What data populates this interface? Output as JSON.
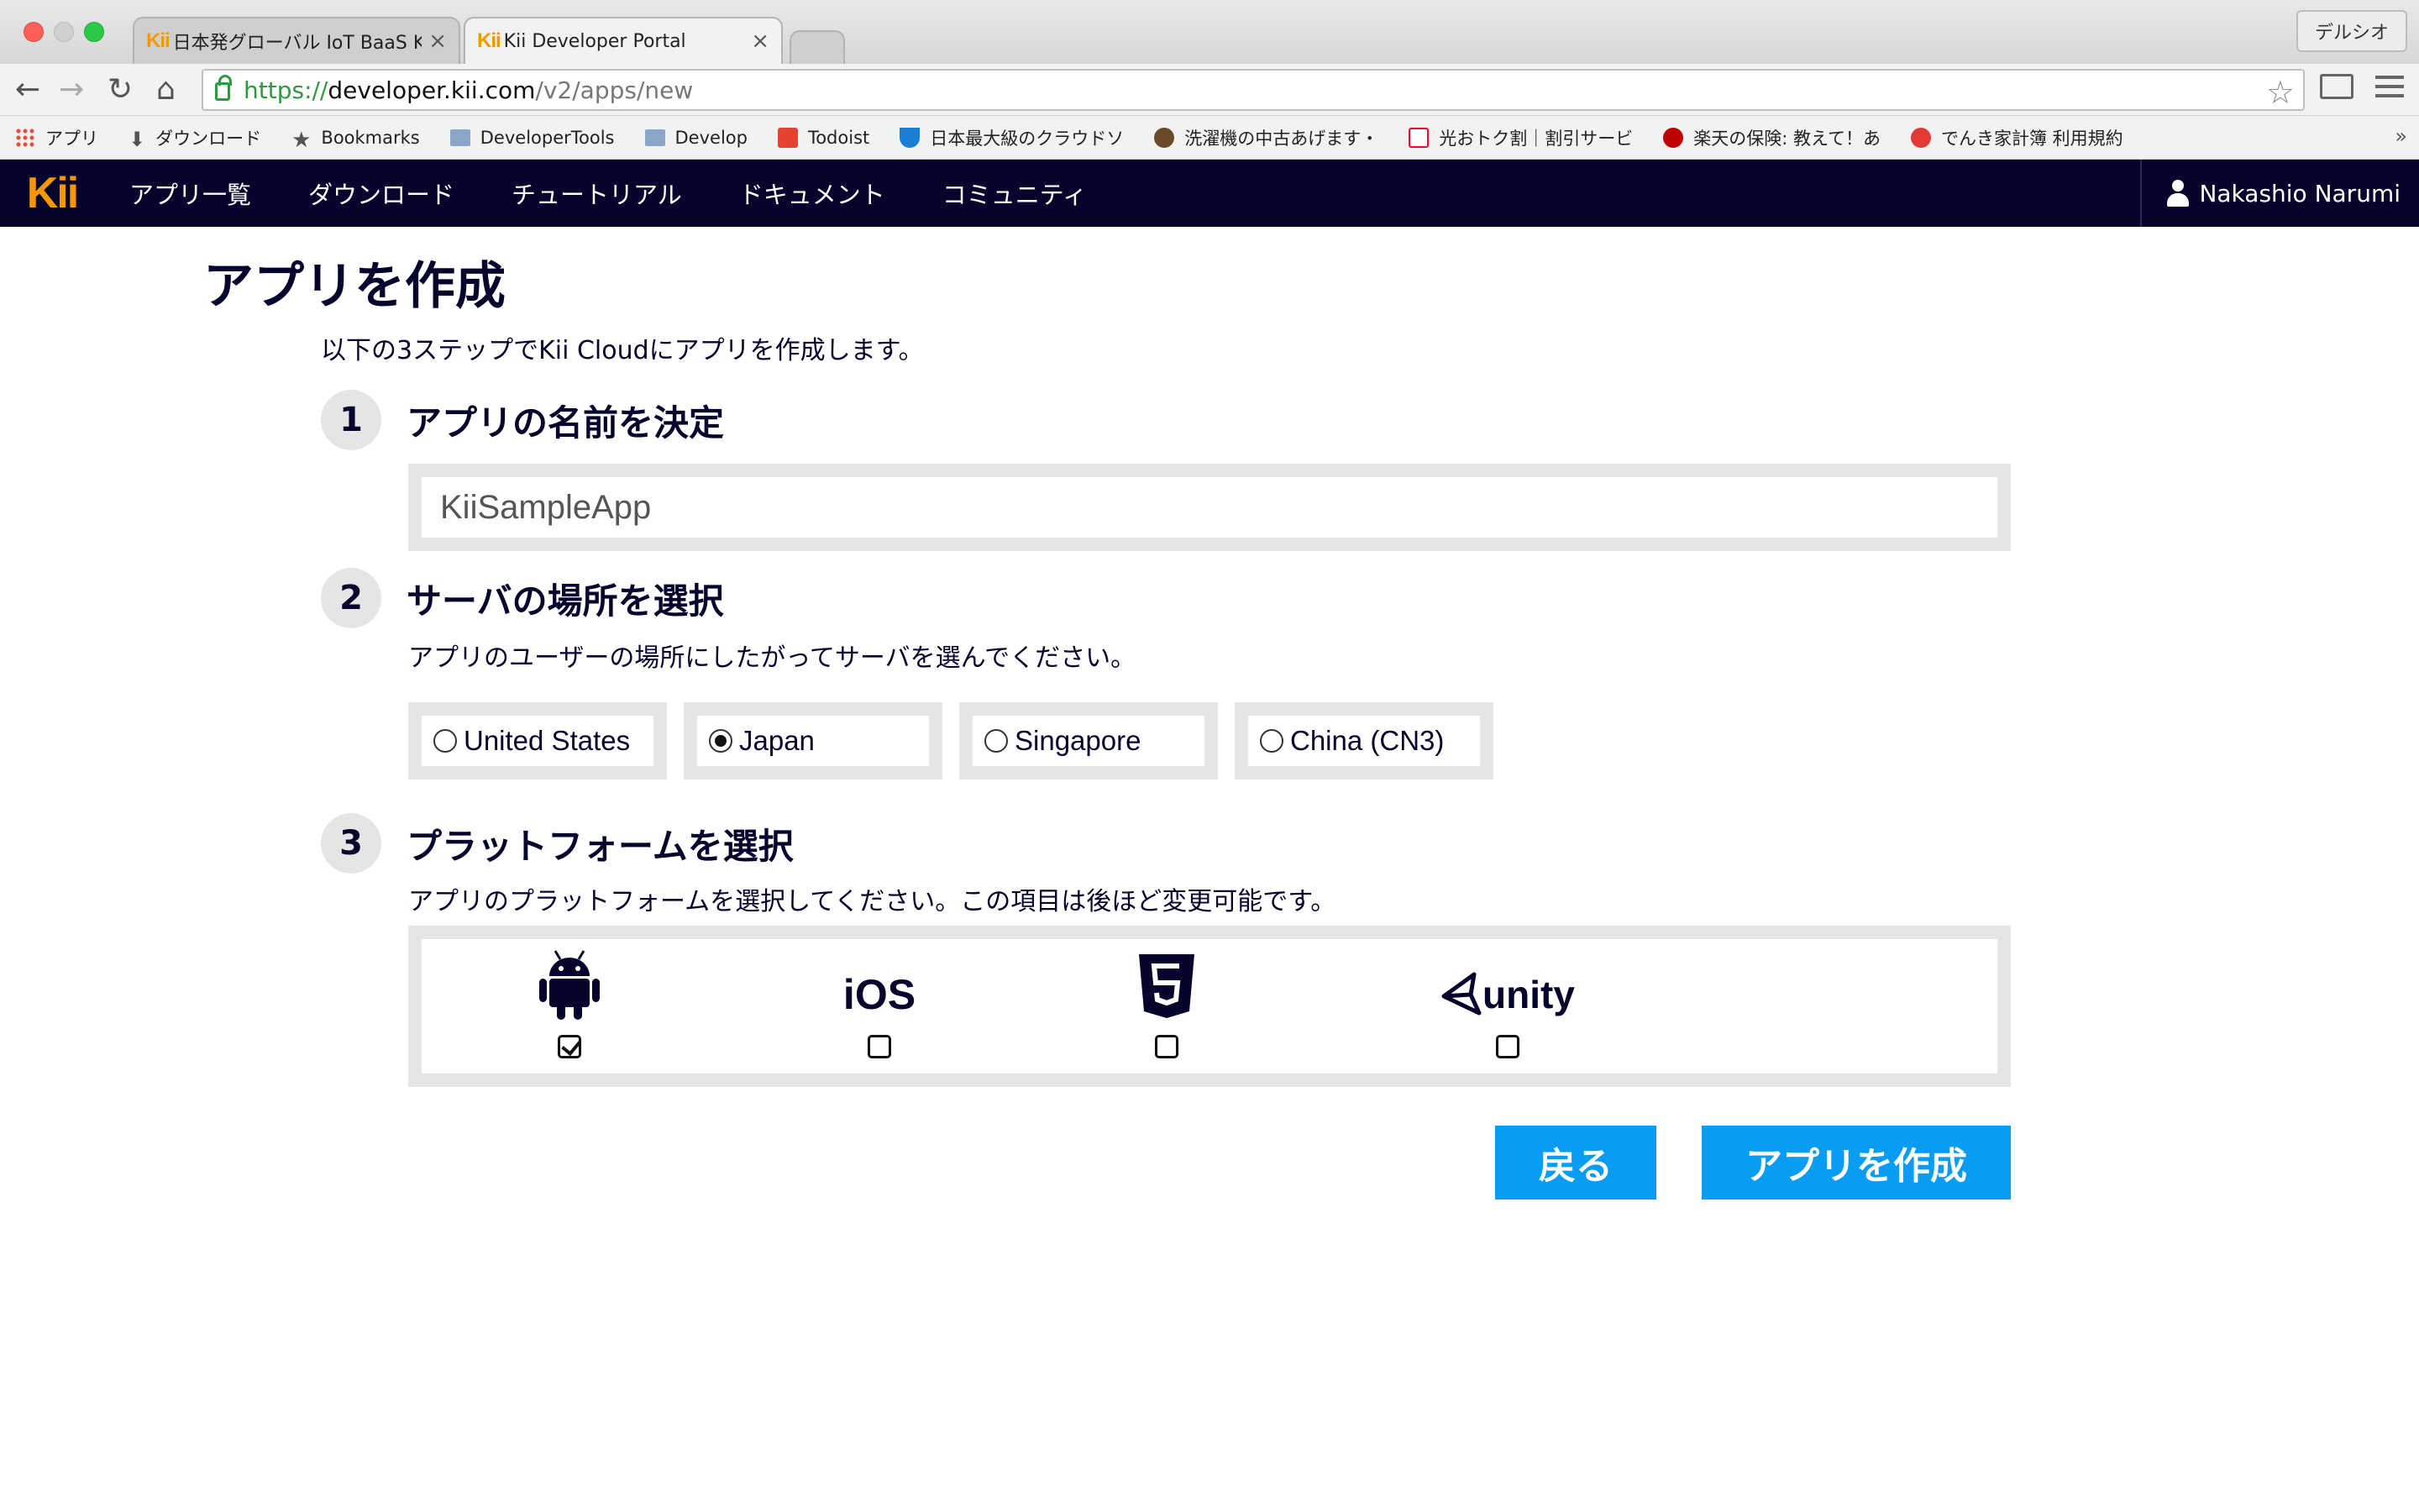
{
  "browser": {
    "tabs": [
      {
        "favicon": "Kii",
        "title": "日本発グローバル IoT BaaS K",
        "close": "×"
      },
      {
        "favicon": "Kii",
        "title": "Kii Developer Portal",
        "close": "×"
      }
    ],
    "profile": "デルシオ",
    "url": {
      "scheme": "https://",
      "host": "developer.kii.com",
      "path": "/v2/apps/new"
    },
    "bookmarks": [
      {
        "icon": "apps-grid-icon",
        "label": "アプリ"
      },
      {
        "icon": "download-icon",
        "label": "ダウンロード"
      },
      {
        "icon": "star-icon",
        "label": "Bookmarks"
      },
      {
        "icon": "folder-icon",
        "label": "DeveloperTools"
      },
      {
        "icon": "folder-icon",
        "label": "Develop"
      },
      {
        "icon": "todoist-icon",
        "label": "Todoist"
      },
      {
        "icon": "u-shield-icon",
        "label": "日本最大級のクラウドソ"
      },
      {
        "icon": "brown-circle-icon",
        "label": "洗濯機の中古あげます・"
      },
      {
        "icon": "yahoo-icon",
        "label": "光おトク割｜割引サービ"
      },
      {
        "icon": "rakuten-icon",
        "label": "楽天の保険: 教えて！あ"
      },
      {
        "icon": "denki-icon",
        "label": "でんき家計簿 利用規約"
      }
    ],
    "bookmarks_more": "»"
  },
  "site_nav": {
    "logo": "Kii",
    "items": [
      "アプリ一覧",
      "ダウンロード",
      "チュートリアル",
      "ドキュメント",
      "コミュニティ"
    ],
    "user": "Nakashio Narumi"
  },
  "page": {
    "title": "アプリを作成",
    "intro": "以下の3ステップでKii Cloudにアプリを作成します。",
    "step1": {
      "number": "1",
      "title": "アプリの名前を決定",
      "app_name_value": "KiiSampleApp"
    },
    "step2": {
      "number": "2",
      "title": "サーバの場所を選択",
      "description": "アプリのユーザーの場所にしたがってサーバを選んでください。",
      "options": [
        "United States",
        "Japan",
        "Singapore",
        "China (CN3)"
      ],
      "selected": "Japan"
    },
    "step3": {
      "number": "3",
      "title": "プラットフォームを選択",
      "description": "アプリのプラットフォームを選択してください。この項目は後ほど変更可能です。",
      "platforms": [
        {
          "name": "Android",
          "icon": "android-icon",
          "checked": true
        },
        {
          "name": "iOS",
          "label": "iOS",
          "checked": false
        },
        {
          "name": "HTML5",
          "icon": "html5-icon",
          "checked": false
        },
        {
          "name": "Unity",
          "label": "unity",
          "checked": false
        }
      ]
    },
    "buttons": {
      "back": "戻る",
      "create": "アプリを作成"
    }
  },
  "colors": {
    "nav_bg": "#05042c",
    "logo": "#f39800",
    "primary_button": "#089cf2",
    "panel_bg": "#e5e5e5"
  }
}
